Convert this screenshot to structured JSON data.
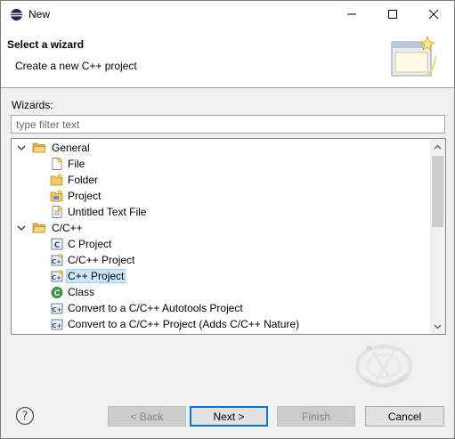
{
  "window": {
    "title": "New"
  },
  "banner": {
    "title": "Select a wizard",
    "description": "Create a new C++ project"
  },
  "wizards_label": "Wizards:",
  "filter": {
    "placeholder": "type filter text",
    "value": ""
  },
  "tree": {
    "items": [
      {
        "label": "General",
        "icon": "folder-open-icon",
        "expanded": true,
        "level": 0
      },
      {
        "label": "File",
        "icon": "file-icon",
        "level": 1
      },
      {
        "label": "Folder",
        "icon": "folder-icon",
        "level": 1
      },
      {
        "label": "Project",
        "icon": "project-icon",
        "level": 1
      },
      {
        "label": "Untitled Text File",
        "icon": "text-file-icon",
        "level": 1
      },
      {
        "label": "C/C++",
        "icon": "folder-open-icon",
        "expanded": true,
        "level": 0
      },
      {
        "label": "C Project",
        "icon": "c-project-icon",
        "level": 1
      },
      {
        "label": "C/C++ Project",
        "icon": "cpp-project-icon",
        "level": 1
      },
      {
        "label": "C++ Project",
        "icon": "cpp-project-icon",
        "level": 1,
        "selected": true
      },
      {
        "label": "Class",
        "icon": "class-icon",
        "level": 1
      },
      {
        "label": "Convert to a C/C++ Autotools Project",
        "icon": "convert-icon",
        "level": 1
      },
      {
        "label": "Convert to a C/C++ Project (Adds C/C++ Nature)",
        "icon": "convert-icon",
        "level": 1
      }
    ]
  },
  "buttons": {
    "back": "< Back",
    "next": "Next >",
    "finish": "Finish",
    "cancel": "Cancel"
  },
  "colors": {
    "selection": "#cce8ff",
    "default_button_border": "#0078d7"
  }
}
